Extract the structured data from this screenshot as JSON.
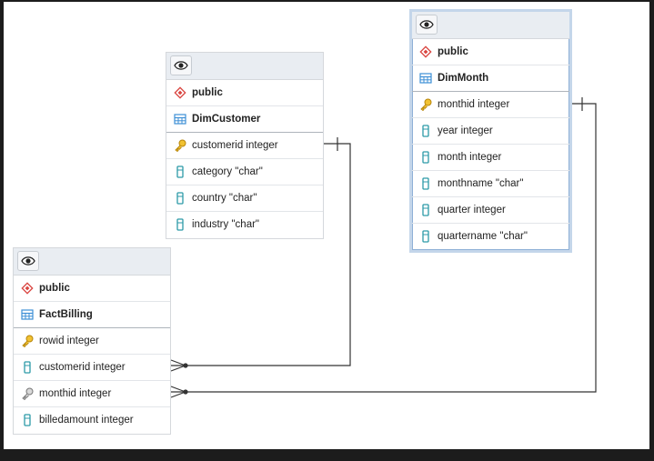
{
  "colors": {
    "accent": "#2c9aa8",
    "key": "#e0a824",
    "schema": "#d9443f",
    "table_icon": "#3d8fd6"
  },
  "tables": {
    "dimcustomer": {
      "schema": "public",
      "name": "DimCustomer",
      "columns": [
        {
          "label": "customerid integer",
          "icon": "primary-key-icon"
        },
        {
          "label": "category \"char\"",
          "icon": "column-icon"
        },
        {
          "label": "country \"char\"",
          "icon": "column-icon"
        },
        {
          "label": "industry \"char\"",
          "icon": "column-icon"
        }
      ]
    },
    "dimmonth": {
      "schema": "public",
      "name": "DimMonth",
      "columns": [
        {
          "label": "monthid integer",
          "icon": "primary-key-icon"
        },
        {
          "label": "year integer",
          "icon": "column-icon"
        },
        {
          "label": "month integer",
          "icon": "column-icon"
        },
        {
          "label": "monthname \"char\"",
          "icon": "column-icon"
        },
        {
          "label": "quarter integer",
          "icon": "column-icon"
        },
        {
          "label": "quartername \"char\"",
          "icon": "column-icon"
        }
      ]
    },
    "factbilling": {
      "schema": "public",
      "name": "FactBilling",
      "columns": [
        {
          "label": "rowid integer",
          "icon": "primary-key-icon"
        },
        {
          "label": "customerid integer",
          "icon": "column-icon"
        },
        {
          "label": "monthid integer",
          "icon": "foreign-key-icon"
        },
        {
          "label": "billedamount integer",
          "icon": "column-icon"
        }
      ]
    }
  }
}
